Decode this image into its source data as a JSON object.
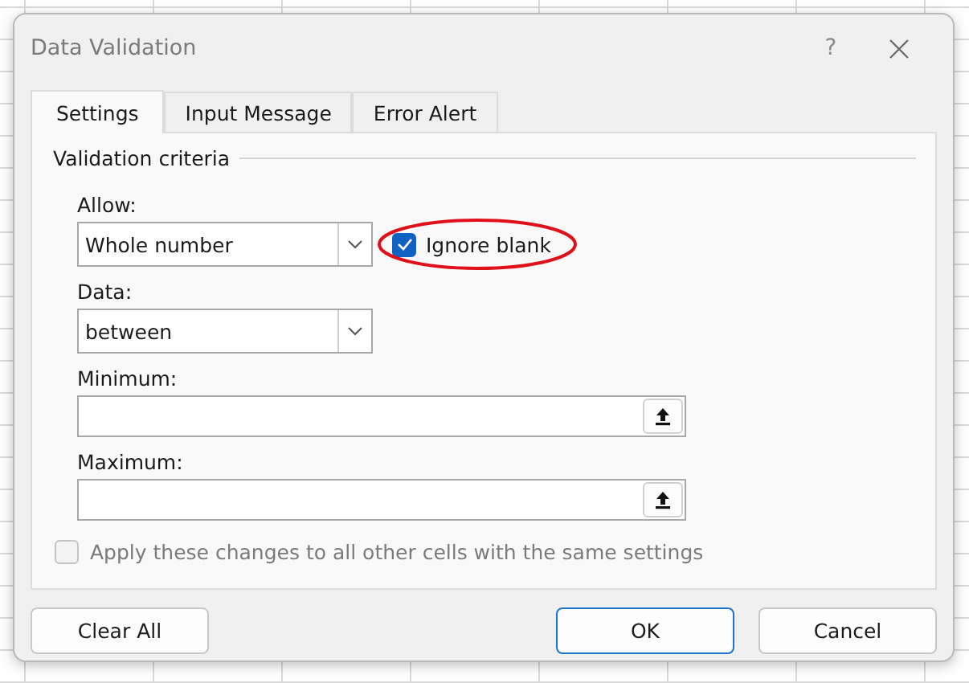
{
  "window": {
    "title": "Data Validation",
    "help": "?"
  },
  "tabs": [
    {
      "label": "Settings",
      "selected": true
    },
    {
      "label": "Input Message",
      "selected": false
    },
    {
      "label": "Error Alert",
      "selected": false
    }
  ],
  "group": {
    "title": "Validation criteria"
  },
  "allow": {
    "label": "Allow:",
    "value": "Whole number"
  },
  "ignore_blank": {
    "label": "Ignore blank",
    "checked": true,
    "disabled": false,
    "annotation": {
      "kind": "ellipse",
      "color": "#e0101a"
    }
  },
  "data": {
    "label": "Data:",
    "value": "between"
  },
  "minimum": {
    "label": "Minimum:"
  },
  "maximum": {
    "label": "Maximum:"
  },
  "apply_all": {
    "label": "Apply these changes to all other cells with the same settings",
    "checked": false,
    "disabled": true
  },
  "buttons": [
    {
      "label": "Clear All",
      "kind": "secondary"
    },
    {
      "label": "OK",
      "kind": "default"
    },
    {
      "label": "Cancel",
      "kind": "secondary"
    }
  ]
}
